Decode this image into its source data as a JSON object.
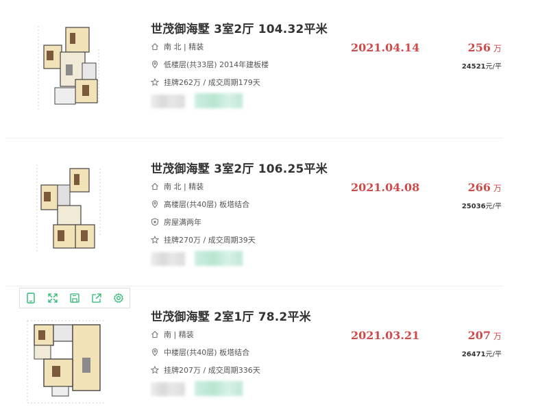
{
  "listings": [
    {
      "title": "世茂御海墅 3室2厅 104.32平米",
      "orientation": "南 北 | 精装",
      "floor": "低楼层(共33层) 2014年建板楼",
      "listing_info": "挂牌262万 / 成交周期179天",
      "deal_date": "2021.04.14",
      "price": "256",
      "price_unit": "万",
      "unit_price": "24521",
      "unit_price_suffix": "元/平"
    },
    {
      "title": "世茂御海墅 3室2厅 106.25平米",
      "orientation": "南 北 | 精装",
      "floor": "高楼层(共40层) 板塔结合",
      "tag": "房屋满两年",
      "listing_info": "挂牌270万 / 成交周期39天",
      "deal_date": "2021.04.08",
      "price": "266",
      "price_unit": "万",
      "unit_price": "25036",
      "unit_price_suffix": "元/平"
    },
    {
      "title": "世茂御海墅 2室1厅 78.2平米",
      "orientation": "南 | 精装",
      "floor": "中楼层(共40层) 板塔结合",
      "listing_info": "挂牌207万 / 成交周期336天",
      "deal_date": "2021.03.21",
      "price": "207",
      "price_unit": "万",
      "unit_price": "26471",
      "unit_price_suffix": "元/平"
    }
  ],
  "toolbar": {
    "icons": [
      "tablet-icon",
      "expand-icon",
      "save-icon",
      "share-icon",
      "gear-icon"
    ],
    "color": "#2bb673"
  },
  "colors": {
    "accent_red": "#d04a4a",
    "text": "#333333",
    "subtext": "#555555"
  }
}
